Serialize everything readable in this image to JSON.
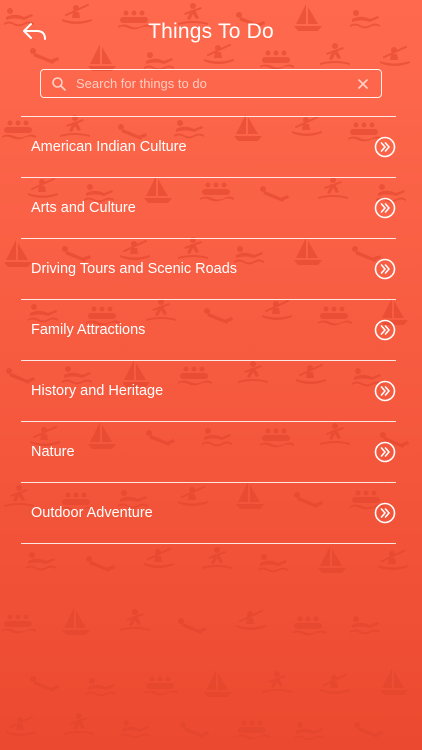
{
  "header": {
    "title": "Things To Do",
    "back_icon": "back-arrow-icon"
  },
  "search": {
    "placeholder": "Search for things to do",
    "value": "",
    "search_icon": "search-icon",
    "clear_icon": "clear-icon"
  },
  "categories": [
    {
      "label": "American Indian Culture",
      "icon": "double-chevron-right-icon"
    },
    {
      "label": "Arts and Culture",
      "icon": "double-chevron-right-icon"
    },
    {
      "label": "Driving Tours and Scenic Roads",
      "icon": "double-chevron-right-icon"
    },
    {
      "label": "Family Attractions",
      "icon": "double-chevron-right-icon"
    },
    {
      "label": "History and Heritage",
      "icon": "double-chevron-right-icon"
    },
    {
      "label": "Nature",
      "icon": "double-chevron-right-icon"
    },
    {
      "label": "Outdoor Adventure",
      "icon": "double-chevron-right-icon"
    }
  ],
  "colors": {
    "background_top": "#ff6a4e",
    "background_bottom": "#ec4a30",
    "pattern": "#e0442c",
    "foreground": "#ffffff"
  },
  "background_pattern_icons": [
    "swimmer-icon",
    "kayak-icon",
    "sailboat-icon",
    "surfer-icon",
    "rafting-icon",
    "diver-icon",
    "water-skier-icon"
  ]
}
